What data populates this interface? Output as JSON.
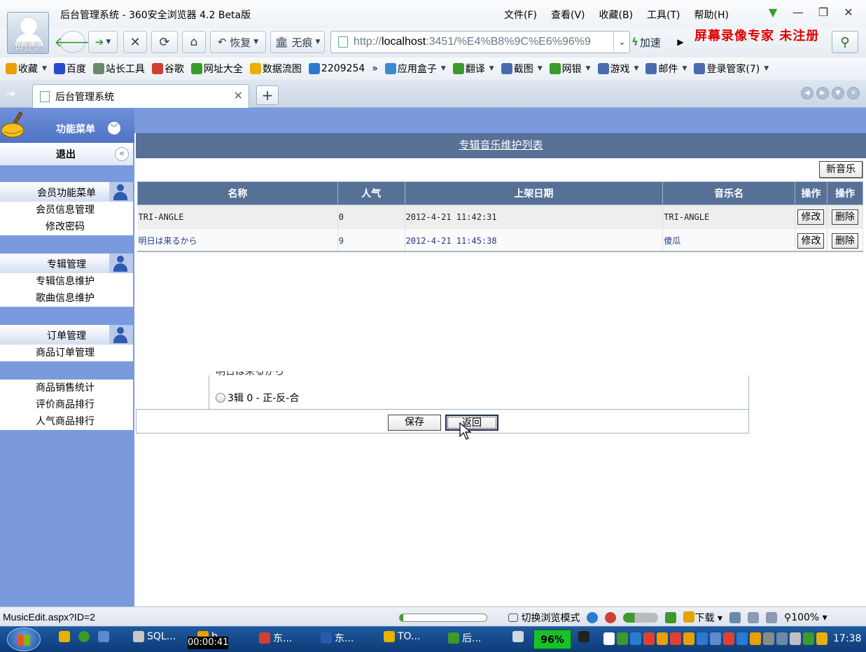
{
  "browser": {
    "avatar_label": "请登录",
    "window_title": "后台管理系统 - 360安全浏览器 4.2 Beta版",
    "menu": [
      "文件(F)",
      "查看(V)",
      "收藏(B)",
      "工具(T)",
      "帮助(H)"
    ],
    "toolbar": {
      "restore_label": "恢复",
      "incognito_label": "无痕",
      "speed_label": "加速",
      "url_prefix": "http://",
      "url_host": "localhost",
      "url_rest": ":3451/%E4%B8%9C%E6%96%9",
      "watermark": "屏幕录像专家  未注册"
    },
    "bookmarks": [
      {
        "label": "收藏",
        "dropdown": true,
        "color": "#e8a000"
      },
      {
        "label": "百度",
        "dropdown": false,
        "color": "#2a4ad0"
      },
      {
        "label": "站长工具",
        "dropdown": false,
        "color": "#6a8a6a"
      },
      {
        "label": "谷歌",
        "dropdown": false,
        "color": "#d04030"
      },
      {
        "label": "网址大全",
        "dropdown": false,
        "color": "#3a9a2a"
      },
      {
        "label": "数据流图",
        "dropdown": false,
        "color": "#e8b000"
      },
      {
        "label": "2209254",
        "dropdown": false,
        "color": "#2a7ad0"
      },
      {
        "label": "»",
        "dropdown": false,
        "color": ""
      },
      {
        "label": "应用盒子",
        "dropdown": true,
        "color": "#3a8ad0"
      },
      {
        "label": "翻译",
        "dropdown": true,
        "color": "#3a9a2a"
      },
      {
        "label": "截图",
        "dropdown": true,
        "color": "#4a6ab0"
      },
      {
        "label": "网银",
        "dropdown": true,
        "color": "#3a9a2a"
      },
      {
        "label": "游戏",
        "dropdown": true,
        "color": "#4a6ab0"
      },
      {
        "label": "邮件",
        "dropdown": true,
        "color": "#4a6ab0"
      },
      {
        "label": "登录管家(7)",
        "dropdown": true,
        "color": "#4a6ab0"
      }
    ],
    "tab_title": "后台管理系统",
    "status_url": "MusicEdit.aspx?ID=2",
    "status_progress": 0.04,
    "status_items": {
      "mode_switch": "切换浏览模式",
      "download": "下载",
      "zoom": "100%"
    }
  },
  "sidebar": {
    "menu_title": "功能菜单",
    "logout": "退出",
    "groups": [
      {
        "title": "会员功能菜单",
        "items": [
          "会员信息管理",
          "修改密码"
        ]
      },
      {
        "title": "专辑管理",
        "items": [
          "专辑信息维护",
          "歌曲信息维护"
        ]
      },
      {
        "title": "订单管理",
        "items": [
          "商品订单管理"
        ]
      }
    ],
    "stats_items": [
      "商品销售统计",
      "评价商品排行",
      "人气商品排行"
    ]
  },
  "main": {
    "list_title": "专辑音乐维护列表",
    "new_button": "新音乐",
    "columns": [
      "名称",
      "人气",
      "上架日期",
      "音乐名",
      "操作",
      "操作"
    ],
    "rows": [
      {
        "name": "TRI-ANGLE",
        "popularity": "0",
        "date": "2012-4-21 11:42:31",
        "music": "TRI-ANGLE",
        "edit": "修改",
        "delete": "删除"
      },
      {
        "name": "明日は来るから",
        "popularity": "9",
        "date": "2012-4-21 11:45:38",
        "music": "傻瓜",
        "edit": "修改",
        "delete": "删除"
      }
    ],
    "form": {
      "clipped_option": "明日は来るから",
      "radio_option": "3辑 0 - 正-反-合",
      "save_label": "保存",
      "back_label": "返回"
    }
  },
  "taskbar": {
    "timer": "00:00:41",
    "items": [
      {
        "label": "SQL...",
        "color": "#c8c8c8"
      },
      {
        "label": "b",
        "color": "#e8a000"
      },
      {
        "label": "东...",
        "color": "#d04030"
      },
      {
        "label": "东...",
        "color": "#2a5ab0"
      },
      {
        "label": "TO...",
        "color": "#e8b000"
      },
      {
        "label": "后...",
        "color": "#3a9a2a"
      }
    ],
    "cpu": "96%",
    "clock": "17:38"
  }
}
